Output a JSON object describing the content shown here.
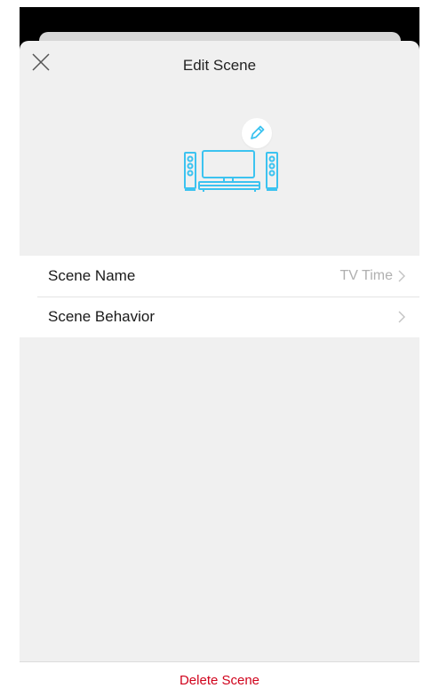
{
  "header": {
    "title": "Edit Scene",
    "close_icon": "close-icon"
  },
  "scene": {
    "icon": "tv-speakers-icon",
    "edit_icon": "pencil-icon",
    "accent": "#3cc3f0"
  },
  "settings": {
    "rows": [
      {
        "label": "Scene Name",
        "value": "TV Time",
        "chevron": "chevron-right-icon"
      },
      {
        "label": "Scene Behavior",
        "value": "",
        "chevron": "chevron-right-icon"
      }
    ]
  },
  "footer": {
    "delete_label": "Delete Scene",
    "delete_color": "#d0021b"
  }
}
